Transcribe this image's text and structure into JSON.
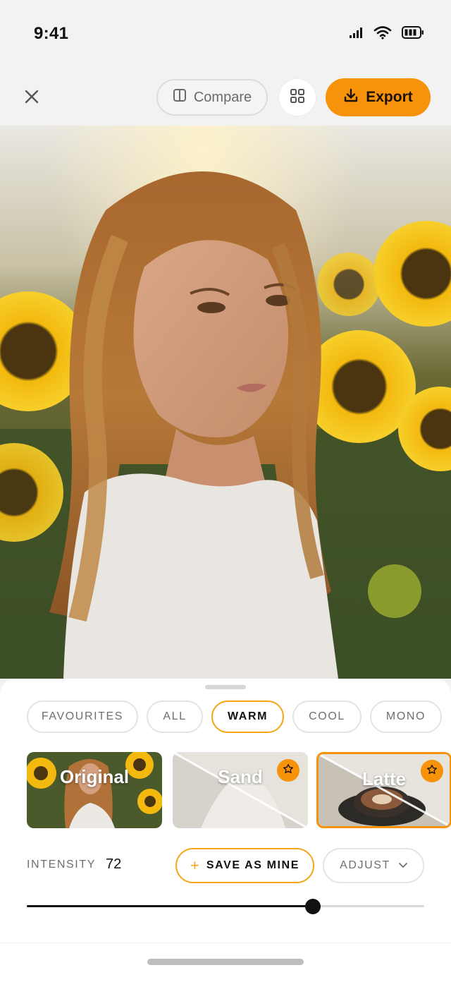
{
  "status_bar": {
    "time": "9:41",
    "icons": [
      "signal-icon",
      "wifi-icon",
      "battery-icon"
    ]
  },
  "toolbar": {
    "close_icon": "close-icon",
    "compare_label": "Compare",
    "compare_icon": "split-view-icon",
    "grid_icon": "grid-icon",
    "export_label": "Export",
    "export_icon": "download-icon"
  },
  "photo": {
    "subject": "portrait-photo"
  },
  "filters": {
    "categories": [
      {
        "label": "FAVOURITES",
        "active": false
      },
      {
        "label": "ALL",
        "active": false
      },
      {
        "label": "WARM",
        "active": true
      },
      {
        "label": "COOL",
        "active": false
      },
      {
        "label": "MONO",
        "active": false
      }
    ],
    "presets": [
      {
        "label": "Original",
        "favourite": false,
        "selected": false
      },
      {
        "label": "Sand",
        "favourite": true,
        "selected": false
      },
      {
        "label": "Latte",
        "favourite": true,
        "selected": true
      }
    ]
  },
  "intensity": {
    "label": "INTENSITY",
    "value": "72",
    "fraction": 0.72
  },
  "actions": {
    "save_label": "SAVE AS MINE",
    "adjust_label": "ADJUST"
  },
  "colors": {
    "accent": "#f7930a",
    "active_border": "#f4a51c"
  }
}
